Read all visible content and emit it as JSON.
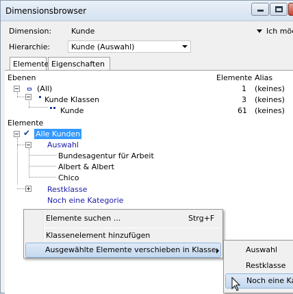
{
  "window": {
    "title": "Dimensionsbrowser"
  },
  "top": {
    "dimension_label": "Dimension:",
    "dimension_value": "Kunde",
    "hierarchy_label": "Hierarchie:",
    "hierarchy_value": "Kunde (Auswahl)",
    "option_text": "Ich möc"
  },
  "tabs": [
    {
      "label": "Elemente",
      "active": true
    },
    {
      "label": "Eigenschaften",
      "active": false
    }
  ],
  "levels": {
    "headers": {
      "name": "Ebenen",
      "elements": "Elemente",
      "alias": "Alias"
    },
    "rows": [
      {
        "name": "(All)",
        "count": "1",
        "alias": "(keines)"
      },
      {
        "name": "Kunde Klassen",
        "count": "3",
        "alias": "(keines)"
      },
      {
        "name": "Kunde",
        "count": "61",
        "alias": "(keines)"
      }
    ]
  },
  "elements": {
    "header": "Elemente",
    "root": "Alle Kunden",
    "group1": "Auswahl",
    "children": [
      "Bundesagentur für Arbeit",
      "Albert & Albert",
      "Chico"
    ],
    "group2": "Restklasse",
    "group3": "Noch eine Kategorie"
  },
  "context_menu": {
    "items": [
      {
        "label": "Elemente suchen ...",
        "shortcut": "Strg+F"
      },
      {
        "label": "Klassenelement hinzufügen"
      },
      {
        "label": "Ausgewählte Elemente verschieben in Klasse",
        "submenu": true
      }
    ]
  },
  "submenu": {
    "items": [
      "Auswahl",
      "Restklasse",
      "Noch eine Ka"
    ]
  },
  "colors": {
    "accent": "#3399ff",
    "link": "#1a1aa8",
    "menu_highlight": "#c3d8ef"
  }
}
